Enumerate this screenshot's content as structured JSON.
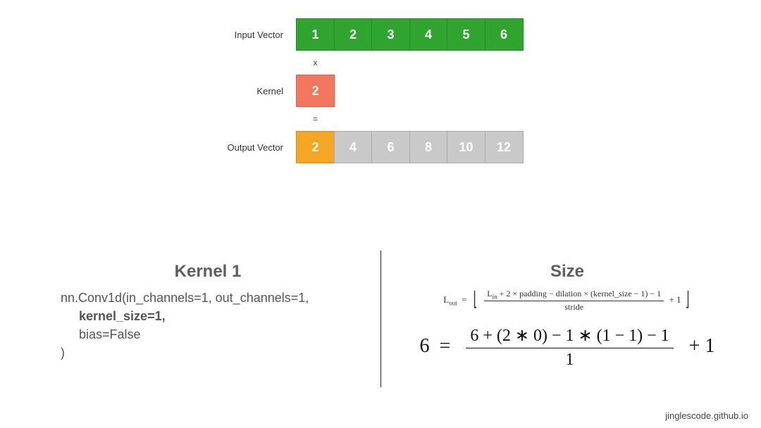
{
  "labels": {
    "input": "Input Vector",
    "kernel": "Kernel",
    "output": "Output Vector",
    "times": "x",
    "equals": "="
  },
  "input_vector": [
    "1",
    "2",
    "3",
    "4",
    "5",
    "6"
  ],
  "kernel_vector": [
    "2"
  ],
  "output_vector": [
    "2",
    "4",
    "6",
    "8",
    "10",
    "12"
  ],
  "output_highlight_index": 0,
  "left_panel": {
    "title": "Kernel 1",
    "code_lines": [
      {
        "text": "nn.Conv1d(in_channels=1, out_channels=1,",
        "bold": false,
        "indent": 0
      },
      {
        "text": "kernel_size=1,",
        "bold": true,
        "indent": 1
      },
      {
        "text": "bias=False",
        "bold": false,
        "indent": 1
      },
      {
        "text": ")",
        "bold": false,
        "indent": 0
      }
    ]
  },
  "right_panel": {
    "title": "Size",
    "formula_general": {
      "lhs": "L",
      "lhs_sub": "out",
      "numerator_parts": [
        "L",
        "in",
        " + 2 × padding − dilation × (kernel_size − 1) − 1"
      ],
      "denominator": "stride",
      "trailer": "+ 1"
    },
    "formula_numeric": {
      "lhs": "6",
      "numerator": "6 + (2 ∗ 0) − 1 ∗ (1 − 1) − 1",
      "denominator": "1",
      "trailer": "+ 1"
    }
  },
  "credit": "jinglescode.github.io",
  "chart_data": {
    "type": "table",
    "title": "1D convolution with kernel_size=1",
    "rows": [
      {
        "name": "Input Vector",
        "values": [
          1,
          2,
          3,
          4,
          5,
          6
        ]
      },
      {
        "name": "Kernel",
        "values": [
          2
        ]
      },
      {
        "name": "Output Vector",
        "values": [
          2,
          4,
          6,
          8,
          10,
          12
        ]
      }
    ],
    "conv_params": {
      "in_channels": 1,
      "out_channels": 1,
      "kernel_size": 1,
      "padding": 0,
      "dilation": 1,
      "stride": 1,
      "bias": false
    },
    "L_in": 6,
    "L_out": 6
  }
}
